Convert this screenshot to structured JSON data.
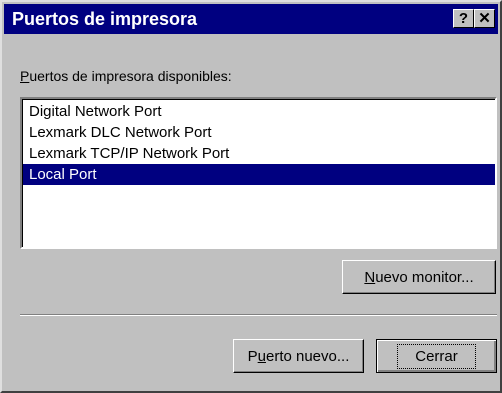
{
  "window": {
    "title": "Puertos de impresora",
    "help_button": "?",
    "close_button": "✕"
  },
  "ports_label": {
    "accel": "P",
    "rest": "uertos de impresora disponibles:"
  },
  "ports": [
    {
      "label": "Digital Network Port",
      "selected": false
    },
    {
      "label": "Lexmark DLC Network Port",
      "selected": false
    },
    {
      "label": "Lexmark TCP/IP Network Port",
      "selected": false
    },
    {
      "label": "Local Port",
      "selected": true
    }
  ],
  "buttons": {
    "new_monitor": {
      "accel": "N",
      "rest": "uevo monitor..."
    },
    "new_port": {
      "pre": "P",
      "accel": "u",
      "rest": "erto nuevo..."
    },
    "close": "Cerrar"
  },
  "colors": {
    "titlebar": "#000080",
    "selection": "#000080",
    "face": "#c0c0c0"
  }
}
